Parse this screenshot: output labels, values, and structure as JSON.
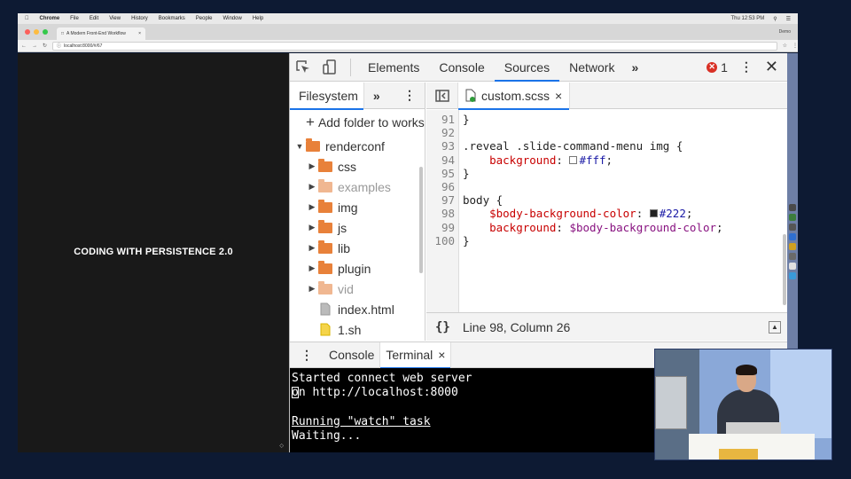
{
  "menubar": {
    "app": "Chrome",
    "items": [
      "File",
      "Edit",
      "View",
      "History",
      "Bookmarks",
      "People",
      "Window",
      "Help"
    ],
    "clock": "Thu 12:53 PM"
  },
  "browser": {
    "tab_title": "A Modern Front-End Workflow",
    "user": "Demo",
    "url": "localhost:8000/#/67"
  },
  "slide": {
    "title": "CODING WITH PERSISTENCE 2.0"
  },
  "devtools": {
    "panels": [
      "Elements",
      "Console",
      "Sources",
      "Network"
    ],
    "active_panel": "Sources",
    "error_count": "1",
    "navigator": {
      "tab": "Filesystem",
      "add_folder_label": "Add folder to workspace",
      "tree": [
        {
          "label": "renderconf",
          "kind": "folder",
          "expanded": true,
          "depth": 0,
          "dim": false
        },
        {
          "label": "css",
          "kind": "folder",
          "expanded": false,
          "depth": 1,
          "dim": false
        },
        {
          "label": "examples",
          "kind": "folder",
          "expanded": false,
          "depth": 1,
          "dim": true
        },
        {
          "label": "img",
          "kind": "folder",
          "expanded": false,
          "depth": 1,
          "dim": false
        },
        {
          "label": "js",
          "kind": "folder",
          "expanded": false,
          "depth": 1,
          "dim": false
        },
        {
          "label": "lib",
          "kind": "folder",
          "expanded": false,
          "depth": 1,
          "dim": false
        },
        {
          "label": "plugin",
          "kind": "folder",
          "expanded": false,
          "depth": 1,
          "dim": false
        },
        {
          "label": "vid",
          "kind": "folder",
          "expanded": false,
          "depth": 1,
          "dim": true
        },
        {
          "label": "index.html",
          "kind": "file",
          "depth": 1,
          "dim": false
        },
        {
          "label": "1.sh",
          "kind": "file-yellow",
          "depth": 1,
          "dim": false
        }
      ]
    },
    "editor": {
      "file_tab": "custom.scss",
      "lines": [
        {
          "n": "91",
          "text": "}"
        },
        {
          "n": "92",
          "text": ""
        },
        {
          "n": "93",
          "text": ".reveal .slide-command-menu img {"
        },
        {
          "n": "94",
          "prop": "background",
          "swatch": "#ffffff",
          "value": "#fff",
          "rest": ";"
        },
        {
          "n": "95",
          "text": "}"
        },
        {
          "n": "96",
          "text": ""
        },
        {
          "n": "97",
          "text": "body {"
        },
        {
          "n": "98",
          "var": "$body-background-color",
          "swatch": "#222222",
          "value": "#222",
          "rest": ";"
        },
        {
          "n": "99",
          "prop": "background",
          "var_value": "$body-background-color",
          "rest": ";"
        },
        {
          "n": "100",
          "text": "}"
        }
      ],
      "status": "Line 98, Column 26",
      "braces": "{}"
    },
    "drawer": {
      "tabs": [
        "Console",
        "Terminal"
      ],
      "active_tab": "Terminal",
      "terminal_lines": [
        {
          "text": "Started connect web server",
          "underline": false
        },
        {
          "text": "on http://localhost:8000",
          "underline": false
        },
        {
          "text": "",
          "underline": false
        },
        {
          "text": "Running \"watch\" task",
          "underline": true
        },
        {
          "text": "Waiting...",
          "underline": false
        }
      ]
    }
  },
  "colors": {
    "accent": "#1a73e8",
    "folder": "#e8813a",
    "error": "#d93025",
    "backdrop": "#0d1a33"
  }
}
